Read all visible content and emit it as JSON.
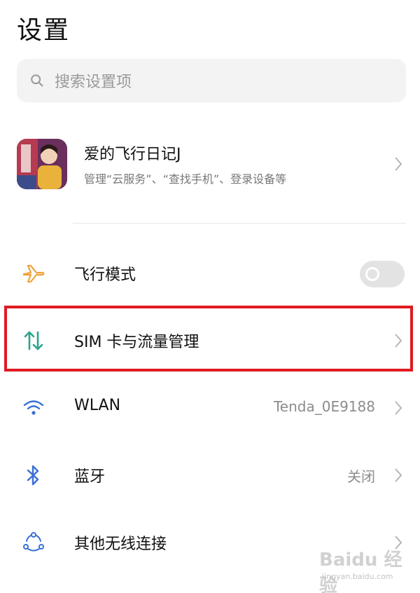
{
  "header": {
    "title": "设置"
  },
  "search": {
    "placeholder": "搜索设置项"
  },
  "account": {
    "name": "爱的飞行日记J",
    "subtitle": "管理“云服务”、“查找手机”、登录设备等"
  },
  "rows": [
    {
      "id": "airplane",
      "label": "飞行模式",
      "icon": "airplane-icon",
      "toggle_on": false
    },
    {
      "id": "sim",
      "label": "SIM 卡与流量管理",
      "icon": "data-transfer-icon",
      "highlighted": true
    },
    {
      "id": "wlan",
      "label": "WLAN",
      "icon": "wifi-icon",
      "value": "Tenda_0E9188"
    },
    {
      "id": "bluetooth",
      "label": "蓝牙",
      "icon": "bluetooth-icon",
      "value": "关闭"
    },
    {
      "id": "other-wireless",
      "label": "其他无线连接",
      "icon": "connections-icon"
    }
  ],
  "watermark": {
    "brand": "Baidu 经验",
    "url": "jingyan.baidu.com"
  },
  "colors": {
    "highlight": "#e01a22",
    "airplane": "#f0a23c",
    "sim": "#2aa58a",
    "wifi": "#3b6fd6",
    "bluetooth": "#3b6fd6"
  }
}
